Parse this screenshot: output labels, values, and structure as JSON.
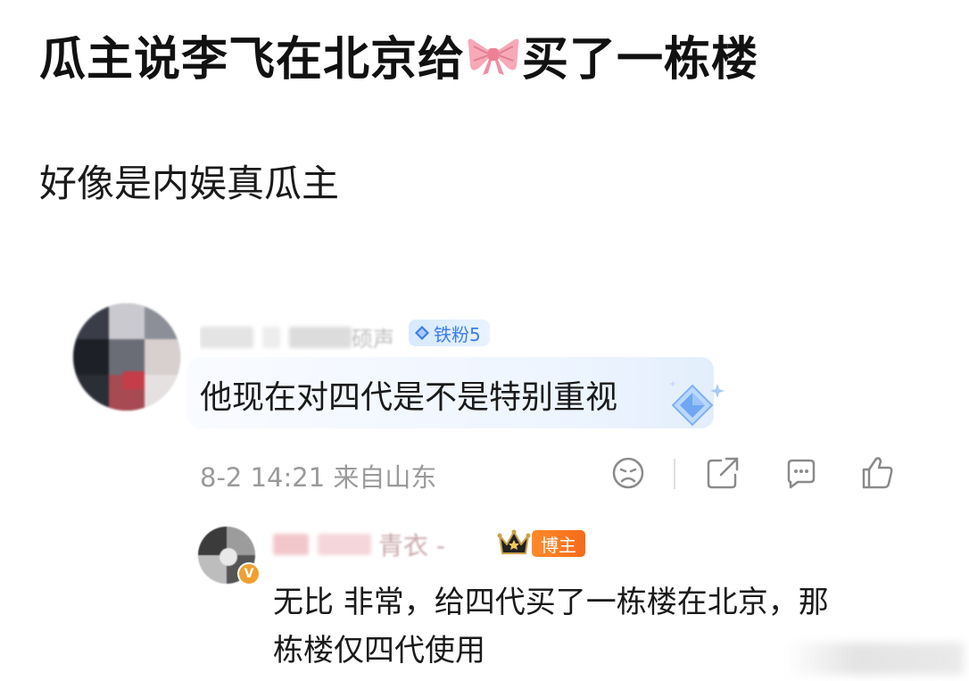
{
  "post": {
    "title_before": "瓜主说李飞在北京给",
    "title_after": "买了一栋楼",
    "subtitle": "好像是内娱真瓜主"
  },
  "comment": {
    "username_visible": "硕声",
    "badge": "铁粉5",
    "text": "他现在对四代是不是特别重视",
    "date": "8-2 14:21",
    "location": "来自山东",
    "actions": [
      "frown-icon",
      "share-icon",
      "comment-icon",
      "like-icon"
    ]
  },
  "reply": {
    "username_visible": "青衣 -",
    "role_badge": "博主",
    "verified_mark": "V",
    "text_line1": "无比 非常，给四代买了一栋楼在北京，那",
    "text_line2": "栋楼仅四代使用"
  },
  "colors": {
    "badge_blue": "#3a7cf0",
    "badge_orange": "#f56a1a",
    "meta_gray": "#9a9a9a"
  }
}
